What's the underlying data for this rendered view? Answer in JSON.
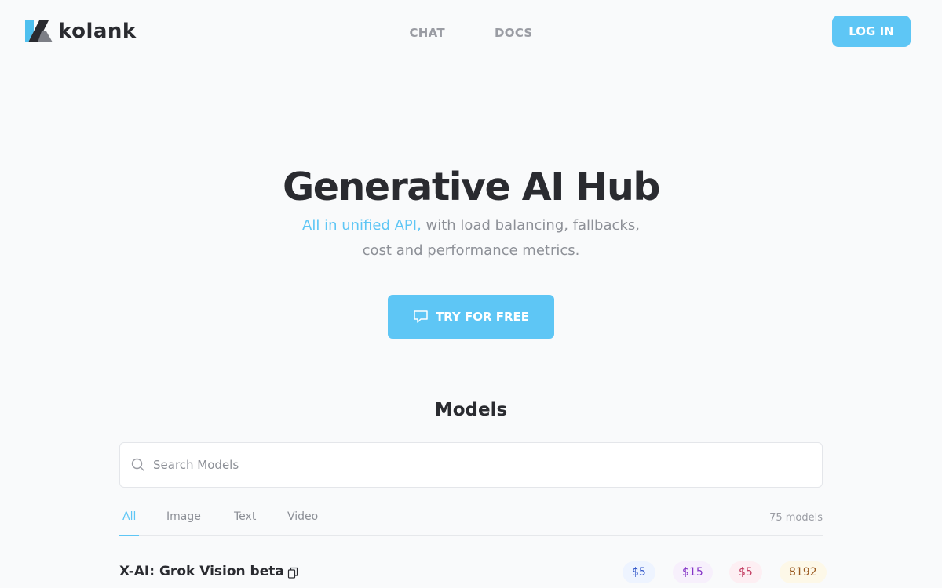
{
  "header": {
    "logo_text": "kolank",
    "nav": [
      {
        "label": "CHAT"
      },
      {
        "label": "DOCS"
      }
    ],
    "login_label": "LOG IN"
  },
  "hero": {
    "title": "Generative AI Hub",
    "subtitle_accent": "All in unified API,",
    "subtitle_line1_rest": " with load balancing, fallbacks,",
    "subtitle_line2": "cost and performance metrics.",
    "cta_label": "TRY FOR FREE",
    "cta_icon": "chat-bubble-icon"
  },
  "models": {
    "title": "Models",
    "search_placeholder": "Search Models",
    "search_value": "",
    "tabs": [
      {
        "label": "All",
        "active": true
      },
      {
        "label": "Image",
        "active": false
      },
      {
        "label": "Text",
        "active": false
      },
      {
        "label": "Video",
        "active": false
      }
    ],
    "count_label": "75 models",
    "rows": [
      {
        "name": "X-AI: Grok Vision beta",
        "badges": [
          "$5",
          "$15",
          "$5",
          "8192"
        ]
      }
    ]
  },
  "colors": {
    "accent": "#5ec6f5",
    "text_dark": "#2a2b30",
    "text_muted": "#8d9097"
  }
}
